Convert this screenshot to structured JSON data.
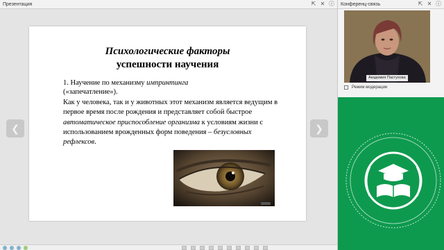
{
  "presentation_panel": {
    "title": "Презентация",
    "controls": [
      "⇱",
      "✕",
      "ⓘ"
    ]
  },
  "slide": {
    "title_line1": "Психологические факторы",
    "title_line2": "успешности научения",
    "p1_prefix": "1. Научение по механизму ",
    "p1_italic": "импринтинга",
    "p1_suffix": "(«запечатление»).",
    "p2_a": "Как у человека, так и у животных этот механизм является ведущим в первое время после рождения и представляет собой быстрое ",
    "p2_italic1": "автоматическое приспособление организма",
    "p2_b": " к условиям жизни с использованием врожденных форм поведения – ",
    "p2_italic2": "безусловных рефлексов",
    "p2_end": "."
  },
  "navigation": {
    "prev_icon": "chevron-left-icon",
    "next_icon": "chevron-right-icon"
  },
  "conference_panel": {
    "title": "Конференц-связь",
    "controls": [
      "⇱",
      "✕",
      "ⓘ"
    ],
    "participant_name": "Академия Пастухова",
    "moderation_label": "Режим модерации"
  },
  "colors": {
    "logo_green": "#0e9a4e",
    "panel_bg": "#e4e4e4"
  }
}
